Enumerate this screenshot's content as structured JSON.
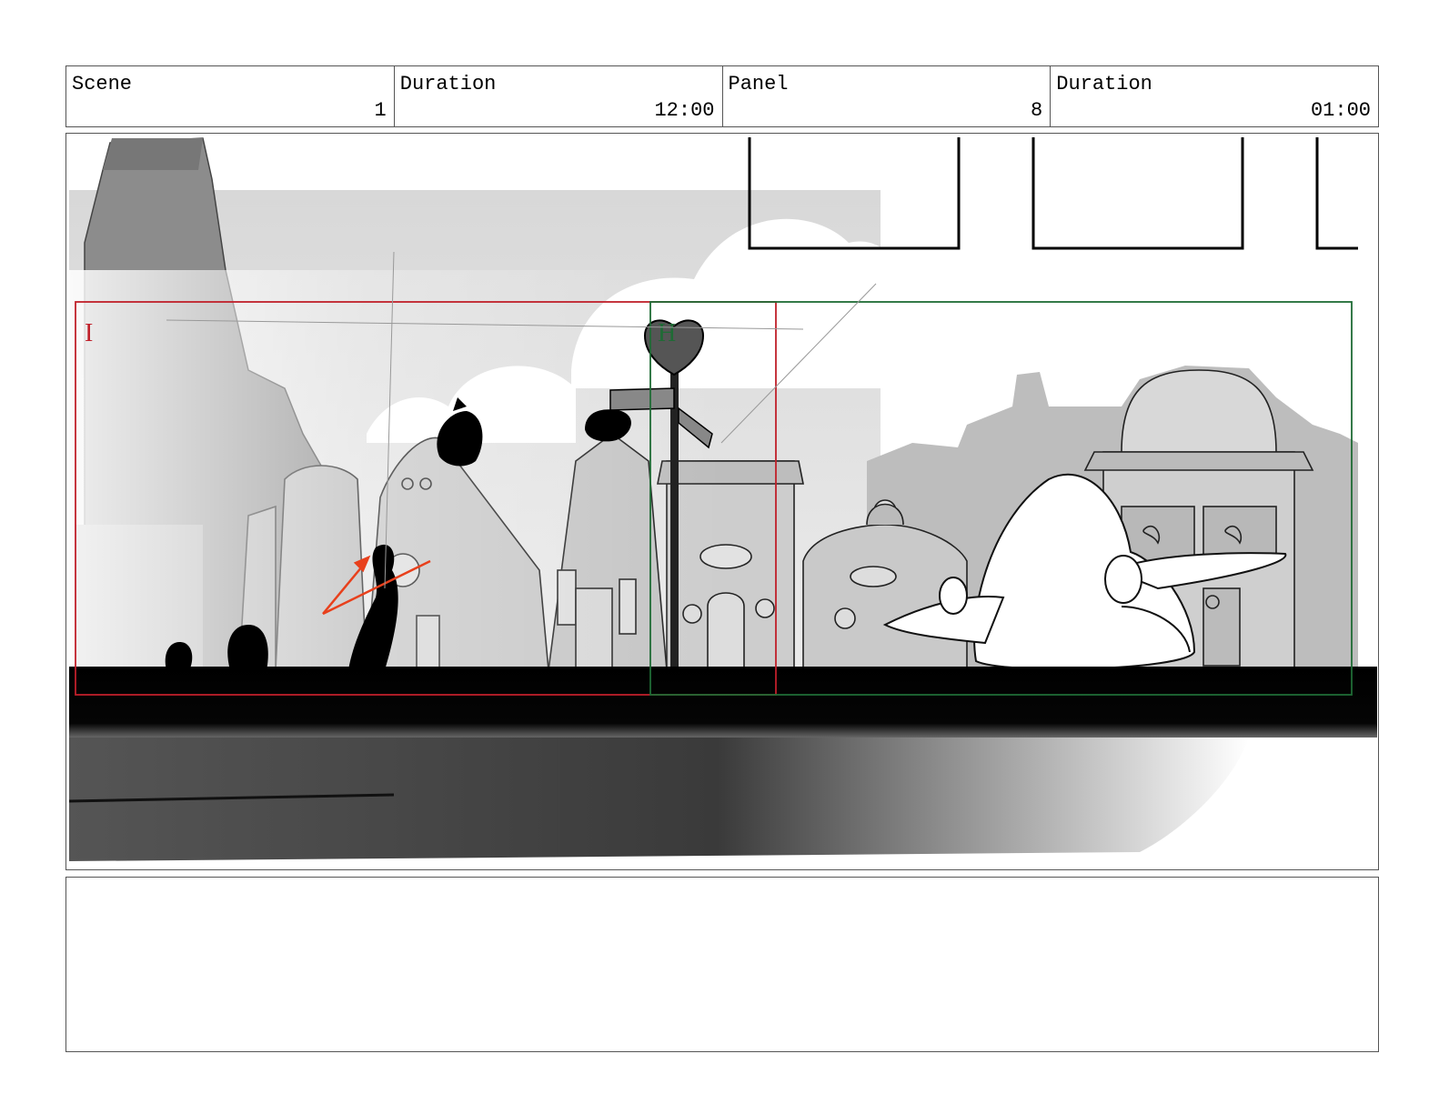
{
  "header": {
    "scene_label": "Scene",
    "scene_value": "1",
    "scene_duration_label": "Duration",
    "scene_duration_value": "12:00",
    "panel_label": "Panel",
    "panel_value": "8",
    "panel_duration_label": "Duration",
    "panel_duration_value": "01:00"
  },
  "panel": {
    "frame_marker_left": "I",
    "frame_marker_right": "H",
    "colors": {
      "marker_left": "#c0202a",
      "marker_right": "#1f6b35",
      "action_arrow": "#e8401c"
    }
  },
  "notes": {
    "text": ""
  }
}
